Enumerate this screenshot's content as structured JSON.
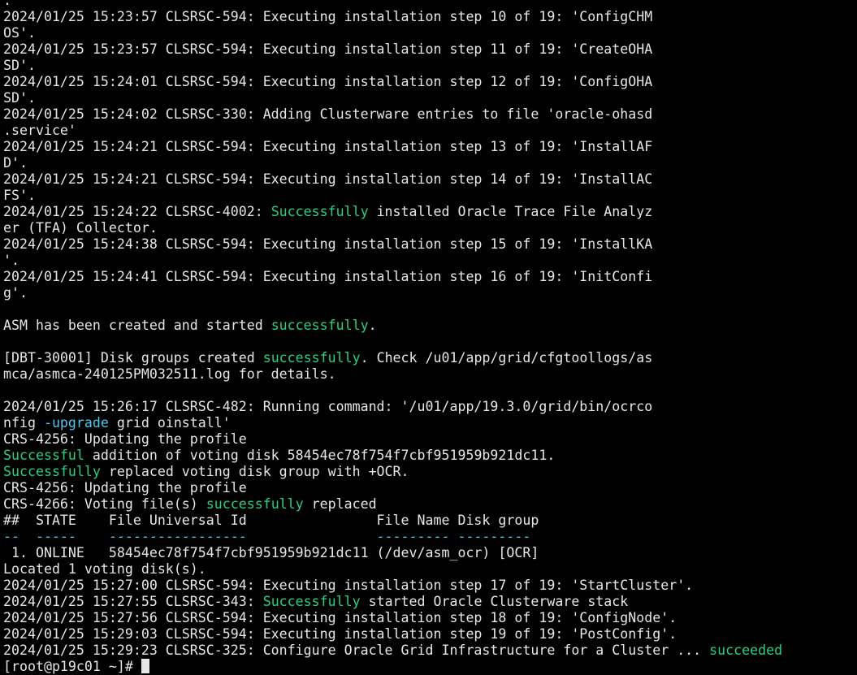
{
  "terminal": {
    "lines": [
      [
        {
          "t": "."
        }
      ],
      [
        {
          "t": "2024/01/25 15:23:57 CLSRSC-594: Executing installation step 10 of 19: 'ConfigCHM"
        }
      ],
      [
        {
          "t": "OS'."
        }
      ],
      [
        {
          "t": "2024/01/25 15:23:57 CLSRSC-594: Executing installation step 11 of 19: 'CreateOHA"
        }
      ],
      [
        {
          "t": "SD'."
        }
      ],
      [
        {
          "t": "2024/01/25 15:24:01 CLSRSC-594: Executing installation step 12 of 19: 'ConfigOHA"
        }
      ],
      [
        {
          "t": "SD'."
        }
      ],
      [
        {
          "t": "2024/01/25 15:24:02 CLSRSC-330: Adding Clusterware entries to file 'oracle-ohasd"
        }
      ],
      [
        {
          "t": ".service'"
        }
      ],
      [
        {
          "t": "2024/01/25 15:24:21 CLSRSC-594: Executing installation step 13 of 19: 'InstallAF"
        }
      ],
      [
        {
          "t": "D'."
        }
      ],
      [
        {
          "t": "2024/01/25 15:24:21 CLSRSC-594: Executing installation step 14 of 19: 'InstallAC"
        }
      ],
      [
        {
          "t": "FS'."
        }
      ],
      [
        {
          "t": "2024/01/25 15:24:22 CLSRSC-4002: "
        },
        {
          "t": "Successfully",
          "c": "g"
        },
        {
          "t": " installed Oracle Trace File Analyz"
        }
      ],
      [
        {
          "t": "er (TFA) Collector."
        }
      ],
      [
        {
          "t": "2024/01/25 15:24:38 CLSRSC-594: Executing installation step 15 of 19: 'InstallKA"
        }
      ],
      [
        {
          "t": "'."
        }
      ],
      [
        {
          "t": "2024/01/25 15:24:41 CLSRSC-594: Executing installation step 16 of 19: 'InitConfi"
        }
      ],
      [
        {
          "t": "g'."
        }
      ],
      [
        {
          "t": ""
        }
      ],
      [
        {
          "t": "ASM has been created and started "
        },
        {
          "t": "successfully",
          "c": "g"
        },
        {
          "t": "."
        }
      ],
      [
        {
          "t": ""
        }
      ],
      [
        {
          "t": "[DBT-30001] Disk groups created "
        },
        {
          "t": "successfully",
          "c": "g"
        },
        {
          "t": ". Check /u01/app/grid/cfgtoollogs/as"
        }
      ],
      [
        {
          "t": "mca/asmca-240125PM032511.log for details."
        }
      ],
      [
        {
          "t": ""
        }
      ],
      [
        {
          "t": "2024/01/25 15:26:17 CLSRSC-482: Running command: '/u01/app/19.3.0/grid/bin/ocrco"
        }
      ],
      [
        {
          "t": "nfig "
        },
        {
          "t": "-upgrade",
          "c": "c"
        },
        {
          "t": " grid oinstall'"
        }
      ],
      [
        {
          "t": "CRS-4256: Updating the profile"
        }
      ],
      [
        {
          "t": "Successful",
          "c": "g"
        },
        {
          "t": " addition of voting disk 58454ec78f754f7cbf951959b921dc11."
        }
      ],
      [
        {
          "t": "Successfully",
          "c": "g"
        },
        {
          "t": " replaced voting disk group with +OCR."
        }
      ],
      [
        {
          "t": "CRS-4256: Updating the profile"
        }
      ],
      [
        {
          "t": "CRS-4266: Voting file(s) "
        },
        {
          "t": "successfully",
          "c": "g"
        },
        {
          "t": " replaced"
        }
      ],
      [
        {
          "t": "##  STATE    File Universal Id                File Name Disk group"
        }
      ],
      [
        {
          "t": "--  -----    -----------------                --------- ---------",
          "c": "c"
        }
      ],
      [
        {
          "t": " 1. ONLINE   58454ec78f754f7cbf951959b921dc11 (/dev/asm_ocr) [OCR]"
        }
      ],
      [
        {
          "t": "Located 1 voting disk(s)."
        }
      ],
      [
        {
          "t": "2024/01/25 15:27:00 CLSRSC-594: Executing installation step 17 of 19: 'StartCluster'."
        }
      ],
      [
        {
          "t": "2024/01/25 15:27:55 CLSRSC-343: "
        },
        {
          "t": "Successfully",
          "c": "g"
        },
        {
          "t": " started Oracle Clusterware stack"
        }
      ],
      [
        {
          "t": "2024/01/25 15:27:56 CLSRSC-594: Executing installation step 18 of 19: 'ConfigNode'."
        }
      ],
      [
        {
          "t": "2024/01/25 15:29:03 CLSRSC-594: Executing installation step 19 of 19: 'PostConfig'."
        }
      ],
      [
        {
          "t": "2024/01/25 15:29:23 CLSRSC-325: Configure Oracle Grid Infrastructure for a Cluster ... "
        },
        {
          "t": "succeeded",
          "c": "g"
        }
      ]
    ],
    "prompt": "[root@p19c01 ~]# "
  }
}
